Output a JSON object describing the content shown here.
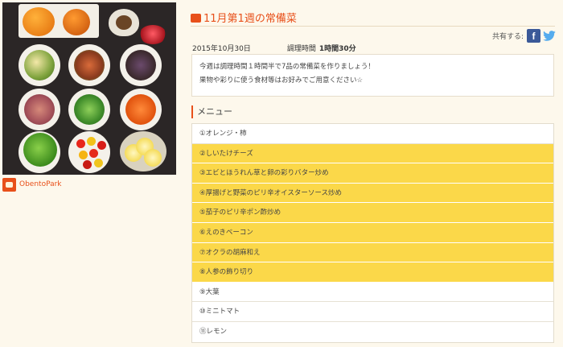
{
  "recipe": {
    "title": "11月第1週の常備菜",
    "date": "2015年10月30日",
    "cook_time_label": "調理時間",
    "cook_time_value": "1時間30分",
    "description_lines": [
      "今週は調理時間１時間半で7品の常備菜を作りましょう！",
      "果物や彩りに使う食材等はお好みでご用意ください☆"
    ]
  },
  "owner": {
    "name": "ObentoPark"
  },
  "share": {
    "label": "共有する:",
    "facebook_glyph": "f",
    "icons": [
      "facebook-icon",
      "twitter-icon"
    ]
  },
  "menu": {
    "heading": "メニュー",
    "items": [
      {
        "label": "①オレンジ・柿",
        "highlighted": false
      },
      {
        "label": "②しいたけチーズ",
        "highlighted": true
      },
      {
        "label": "③エビとほうれん草と卵の彩りバター炒め",
        "highlighted": true
      },
      {
        "label": "④厚揚げと野菜のピリ辛オイスターソース炒め",
        "highlighted": true
      },
      {
        "label": "⑤茄子のピリ辛ポン酢炒め",
        "highlighted": true
      },
      {
        "label": "⑥えのきベーコン",
        "highlighted": true
      },
      {
        "label": "⑦オクラの胡麻和え",
        "highlighted": true
      },
      {
        "label": "⑧人参の飾り切り",
        "highlighted": true
      },
      {
        "label": "⑨大葉",
        "highlighted": false
      },
      {
        "label": "⑩ミニトマト",
        "highlighted": false
      },
      {
        "label": "⑪レモン",
        "highlighted": false
      }
    ]
  },
  "colors": {
    "accent": "#e8501a",
    "highlight": "#fbd849",
    "background": "#fdf8ec",
    "facebook": "#3b5998",
    "twitter": "#55acee"
  }
}
